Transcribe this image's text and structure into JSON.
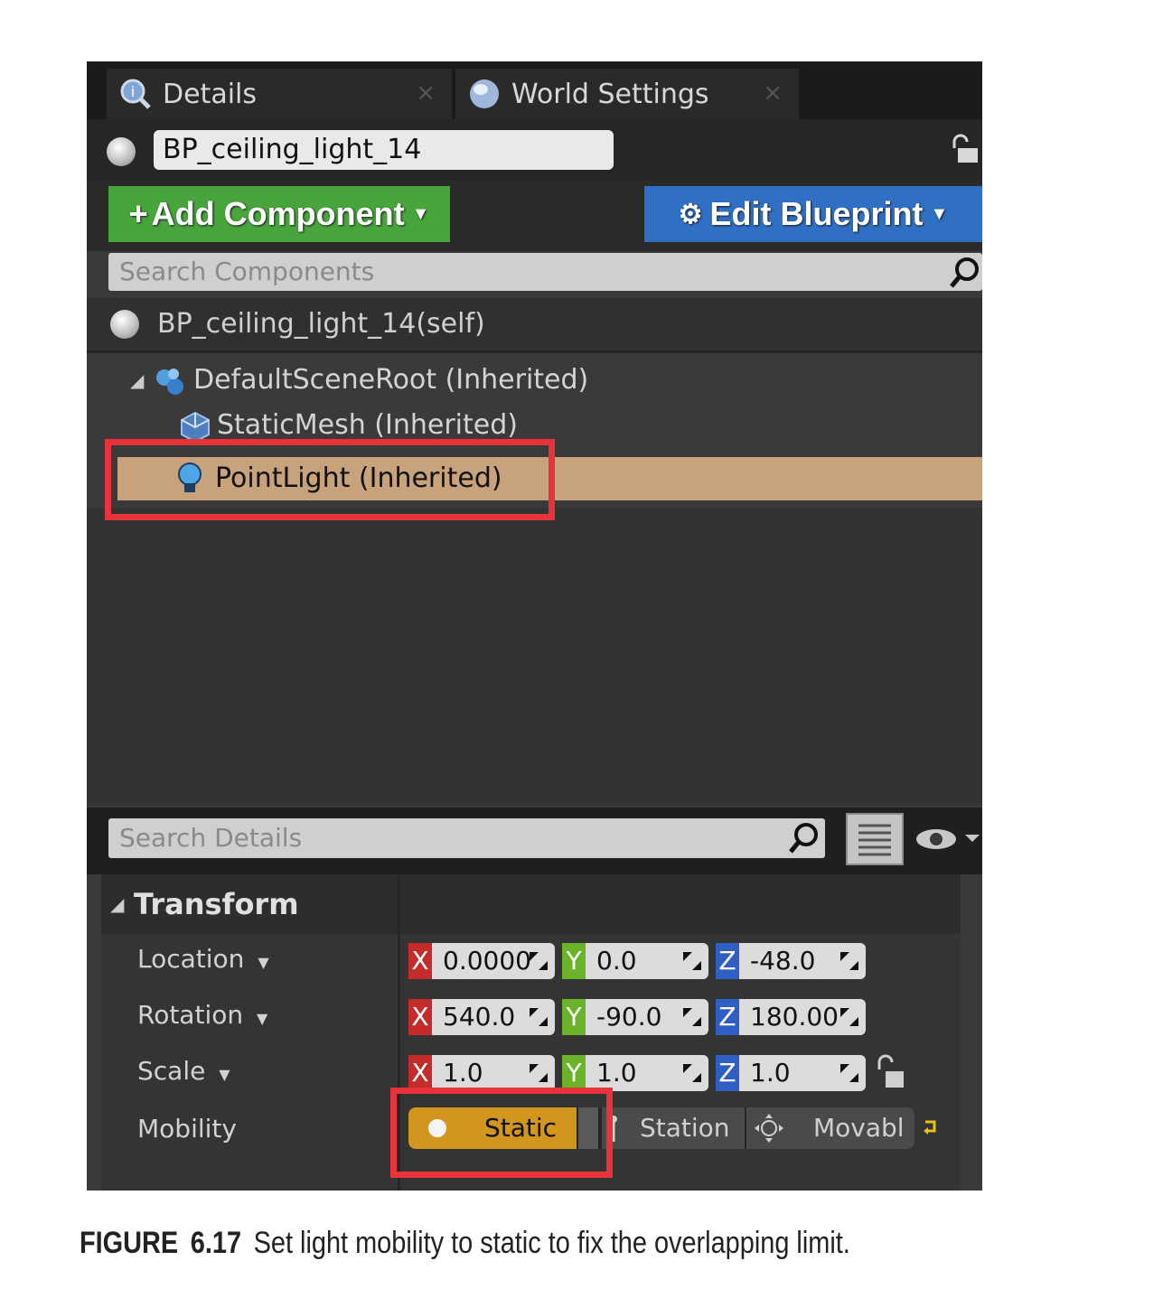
{
  "tabs": [
    {
      "label": "Details",
      "icon": "details-icon",
      "close": "×"
    },
    {
      "label": "World Settings",
      "icon": "globe-icon",
      "close": "×"
    }
  ],
  "actor_name": "BP_ceiling_light_14",
  "buttons": {
    "add_component": "Add Component",
    "edit_blueprint": "Edit Blueprint"
  },
  "component_search": {
    "placeholder": "Search Components"
  },
  "components": {
    "self": "BP_ceiling_light_14(self)",
    "root": "DefaultSceneRoot (Inherited)",
    "mesh": "StaticMesh (Inherited)",
    "light": "PointLight (Inherited)"
  },
  "details_search": {
    "placeholder": "Search Details"
  },
  "transform": {
    "header": "Transform",
    "location": {
      "label": "Location",
      "x": "0.0000",
      "y": "0.0",
      "z": "-48.0"
    },
    "rotation": {
      "label": "Rotation",
      "x": "540.0",
      "y": "-90.0",
      "z": "180.00"
    },
    "scale": {
      "label": "Scale",
      "x": "1.0",
      "y": "1.0",
      "z": "1.0"
    },
    "mobility": {
      "label": "Mobility",
      "options": [
        "Static",
        "Station",
        "Movabl"
      ],
      "selected": "Static"
    }
  },
  "axis_labels": {
    "x": "X",
    "y": "Y",
    "z": "Z"
  },
  "colors": {
    "add_button": "#47a53c",
    "edit_button": "#2f70c4",
    "selected_row": "#c8a27a",
    "static_selected": "#d2961f",
    "highlight": "#e8333a",
    "axis_x": "#c62b2b",
    "axis_y": "#6bb42a",
    "axis_z": "#2f5fc4"
  },
  "caption": {
    "label": "FIGURE",
    "number": "6.17",
    "text": "Set light mobility to static to fix the overlapping limit."
  }
}
